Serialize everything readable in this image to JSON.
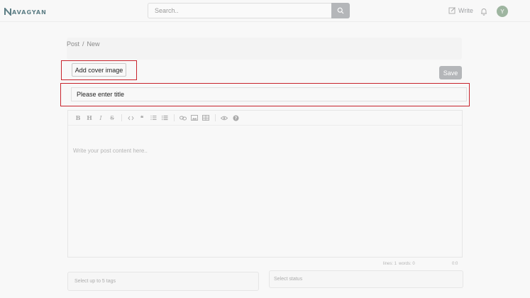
{
  "header": {
    "logo_text": "AVAGYAN",
    "search_placeholder": "Search..",
    "write_label": "Write",
    "avatar_initial": "Y"
  },
  "breadcrumb": {
    "items": [
      "Post",
      "/",
      "New"
    ]
  },
  "editor": {
    "cover_button_label": "Add cover image",
    "save_label": "Save",
    "title_placeholder": "Please enter title",
    "content_placeholder": "Write your post content here..",
    "toolbar": [
      "bold",
      "heading",
      "italic",
      "strikethrough",
      "code",
      "quote",
      "ordered-list",
      "unordered-list",
      "link",
      "image",
      "table",
      "preview",
      "guide"
    ],
    "status_lines": "lines: 1",
    "status_words": "words: 0",
    "status_time": "0:0"
  },
  "tags": {
    "placeholder": "Select up to 5 tags"
  },
  "status_select": {
    "placeholder": "Select status"
  },
  "colors": {
    "highlight": "#c8232c",
    "save_button": "#b4b6b9",
    "avatar": "#9eb5a0",
    "logo": "#5e7f86"
  }
}
